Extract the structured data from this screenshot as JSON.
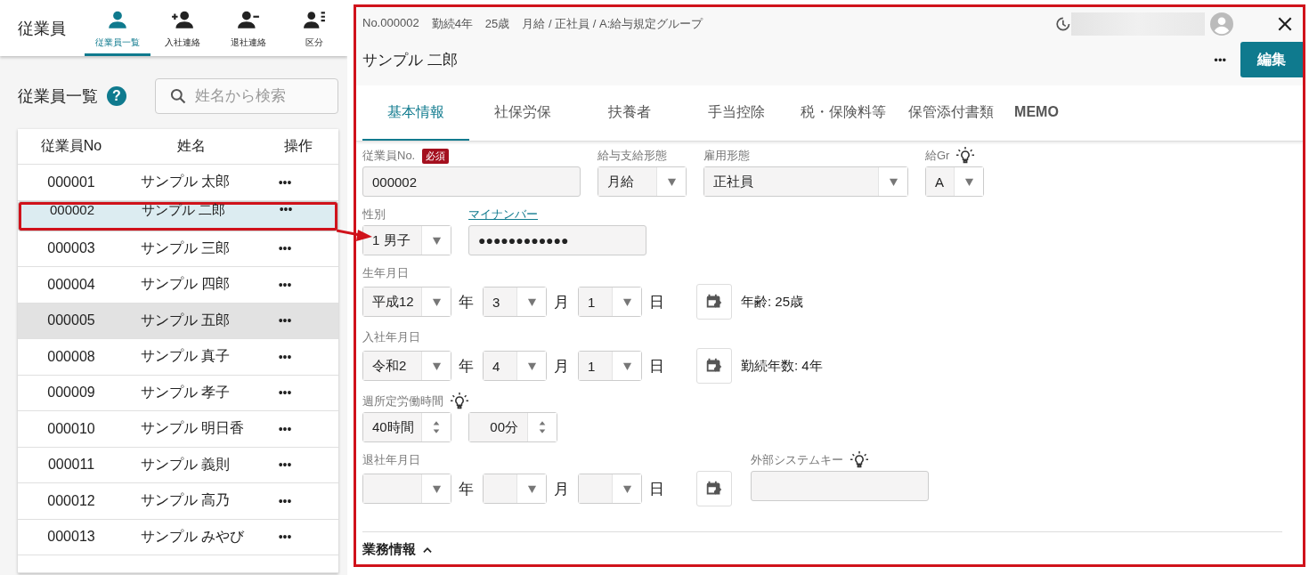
{
  "app_bar": {
    "title": "従業員",
    "nav": [
      {
        "label": "従業員一覧",
        "kind": "person",
        "selected": true
      },
      {
        "label": "入社連絡",
        "kind": "add",
        "selected": false
      },
      {
        "label": "退社連絡",
        "kind": "remove",
        "selected": false
      },
      {
        "label": "区分",
        "kind": "list",
        "selected": false
      }
    ]
  },
  "list": {
    "title": "従業員一覧",
    "help": "?",
    "search": {
      "placeholder": "姓名から検索"
    },
    "columns": [
      "従業員No",
      "姓名",
      "操作"
    ],
    "rows": [
      {
        "no": "000001",
        "name": "サンプル 太郎",
        "action": "•••",
        "selected": false,
        "hovered": false
      },
      {
        "no": "000002",
        "name": "サンプル 二郎",
        "action": "•••",
        "selected": true,
        "hovered": false
      },
      {
        "no": "000003",
        "name": "サンプル 三郎",
        "action": "•••",
        "selected": false,
        "hovered": false
      },
      {
        "no": "000004",
        "name": "サンプル 四郎",
        "action": "•••",
        "selected": false,
        "hovered": false
      },
      {
        "no": "000005",
        "name": "サンプル 五郎",
        "action": "•••",
        "selected": false,
        "hovered": true
      },
      {
        "no": "000008",
        "name": "サンプル 真子",
        "action": "•••",
        "selected": false,
        "hovered": false
      },
      {
        "no": "000009",
        "name": "サンプル 孝子",
        "action": "•••",
        "selected": false,
        "hovered": false
      },
      {
        "no": "000010",
        "name": "サンプル 明日香",
        "action": "•••",
        "selected": false,
        "hovered": false
      },
      {
        "no": "000011",
        "name": "サンプル 義則",
        "action": "•••",
        "selected": false,
        "hovered": false
      },
      {
        "no": "000012",
        "name": "サンプル 高乃",
        "action": "•••",
        "selected": false,
        "hovered": false
      },
      {
        "no": "000013",
        "name": "サンプル みやび",
        "action": "•••",
        "selected": false,
        "hovered": false
      }
    ]
  },
  "panel": {
    "summary": [
      "No.000002",
      "勤続4年",
      "25歳",
      "月給 / 正社員 / A:給与規定グループ"
    ],
    "name": "サンプル 二郎",
    "more": "•••",
    "edit_button": "編集",
    "tabs": [
      {
        "label": "基本情報",
        "selected": true
      },
      {
        "label": "社保労保",
        "selected": false
      },
      {
        "label": "扶養者",
        "selected": false
      },
      {
        "label": "手当控除",
        "selected": false
      },
      {
        "label": "税・保険料等",
        "selected": false
      },
      {
        "label": "保管添付書類",
        "selected": false
      },
      {
        "label": "MEMO",
        "selected": false
      }
    ],
    "employee_no": {
      "label": "従業員No.",
      "badge": "必須",
      "value": "000002"
    },
    "pay_type": {
      "label": "給与支給形態",
      "value": "月給"
    },
    "employment_type": {
      "label": "雇用形態",
      "value": "正社員"
    },
    "pay_group": {
      "label": "給Gr",
      "value": "A"
    },
    "gender": {
      "label": "性別",
      "value": "1 男子"
    },
    "my_number": {
      "label": "マイナンバー",
      "value": "●●●●●●●●●●●●"
    },
    "birth_date": {
      "label": "生年月日",
      "parts": [
        {
          "value": "平成12",
          "unit": "年"
        },
        {
          "value": "3",
          "unit": "月"
        },
        {
          "value": "1",
          "unit": "日"
        }
      ],
      "info": "年齢: 25歳"
    },
    "hire_date": {
      "label": "入社年月日",
      "parts": [
        {
          "value": "令和2",
          "unit": "年"
        },
        {
          "value": "4",
          "unit": "月"
        },
        {
          "value": "1",
          "unit": "日"
        }
      ],
      "info": "勤続年数: 4年"
    },
    "weekly_hours": {
      "label": "週所定労働時間",
      "hours": "40時間",
      "minutes": "00分"
    },
    "retire_date": {
      "label": "退社年月日",
      "parts": [
        {
          "unit": "年"
        },
        {
          "unit": "月"
        },
        {
          "unit": "日"
        }
      ]
    },
    "external_key": {
      "label": "外部システムキー"
    },
    "section": {
      "title": "業務情報",
      "expanded": true
    }
  }
}
